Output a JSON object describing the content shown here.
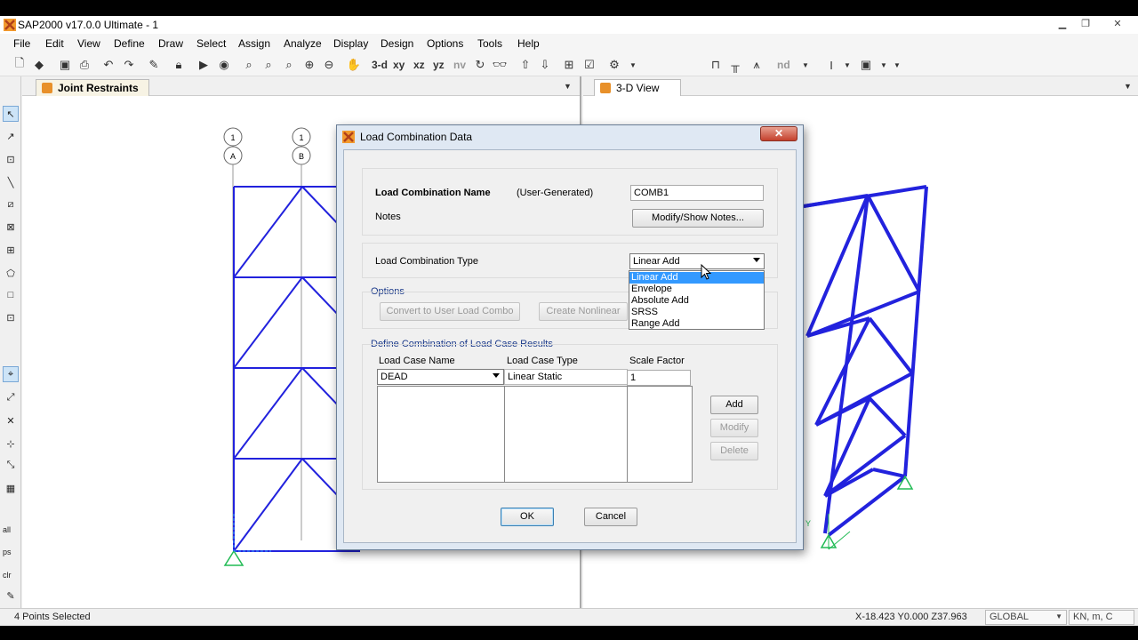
{
  "window": {
    "title": "SAP2000 v17.0.0 Ultimate  - 1"
  },
  "menu": [
    "File",
    "Edit",
    "View",
    "Define",
    "Draw",
    "Select",
    "Assign",
    "Analyze",
    "Display",
    "Design",
    "Options",
    "Tools",
    "Help"
  ],
  "toolbar": {
    "view_3d": "3-d",
    "view_xy": "xy",
    "view_xz": "xz",
    "view_yz": "yz",
    "view_nv": "nv",
    "nd": "nd"
  },
  "left_tools": {
    "all": "all",
    "ps": "ps",
    "clr": "clr"
  },
  "panes": {
    "left": {
      "tab": "Joint Restraints",
      "grid_labels": [
        "1",
        "1",
        "1",
        "A",
        "B"
      ]
    },
    "right": {
      "tab": "3-D View",
      "axis_y": "Y"
    }
  },
  "dialog": {
    "title": "Load Combination Data",
    "close": "✕",
    "name_label": "Load Combination Name",
    "name_hint": "(User-Generated)",
    "name_value": "COMB1",
    "notes_label": "Notes",
    "notes_button": "Modify/Show Notes...",
    "type_label": "Load Combination Type",
    "type_value": "Linear Add",
    "type_options": [
      "Linear Add",
      "Envelope",
      "Absolute Add",
      "SRSS",
      "Range Add"
    ],
    "type_selected_index": 0,
    "options_label": "Options",
    "convert_button": "Convert to User Load Combo",
    "create_nonlinear_button": "Create Nonlinear",
    "define_label": "Define Combination of Load Case Results",
    "columns": [
      "Load Case Name",
      "Load Case Type",
      "Scale Factor"
    ],
    "row": {
      "case_name": "DEAD",
      "case_type": "Linear Static",
      "scale": "1"
    },
    "add_button": "Add",
    "modify_button": "Modify",
    "delete_button": "Delete",
    "ok_button": "OK",
    "cancel_button": "Cancel"
  },
  "status": {
    "selection": "4 Points Selected",
    "coords": "X-18.423  Y0.000  Z37.963",
    "coord_system": "GLOBAL",
    "units": "KN, m, C"
  },
  "colors": {
    "frame": "#2222dd",
    "selection": "#3399ff",
    "restraint": "#22bb55"
  }
}
